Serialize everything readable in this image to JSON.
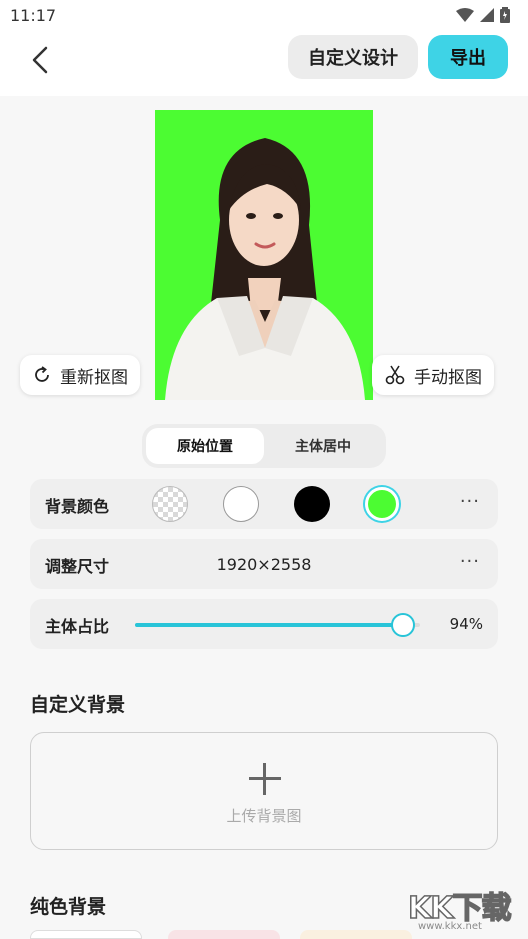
{
  "status_bar": {
    "time": "11:17"
  },
  "header": {
    "custom_design_label": "自定义设计",
    "export_label": "导出"
  },
  "photo": {
    "background_color": "#4cfc32"
  },
  "photo_actions": {
    "redo_label": "重新抠图",
    "manual_label": "手动抠图"
  },
  "position_toggle": {
    "options": [
      "原始位置",
      "主体居中"
    ],
    "selected": "原始位置"
  },
  "background_color_row": {
    "label": "背景颜色",
    "swatches": [
      "transparent",
      "#ffffff",
      "#000000",
      "#4cfc32"
    ],
    "selected": "#4cfc32",
    "more": "···"
  },
  "size_row": {
    "label": "调整尺寸",
    "value": "1920×2558",
    "more": "···"
  },
  "ratio_row": {
    "label": "主体占比",
    "percent": 94,
    "value_text": "94%"
  },
  "custom_background": {
    "title": "自定义背景",
    "upload_label": "上传背景图"
  },
  "solid_background": {
    "title": "纯色背景"
  },
  "watermark": {
    "text": "KK下载",
    "url": "www.kkx.net"
  },
  "colors": {
    "accent": "#3ed3e6",
    "slider": "#28c4d8"
  }
}
